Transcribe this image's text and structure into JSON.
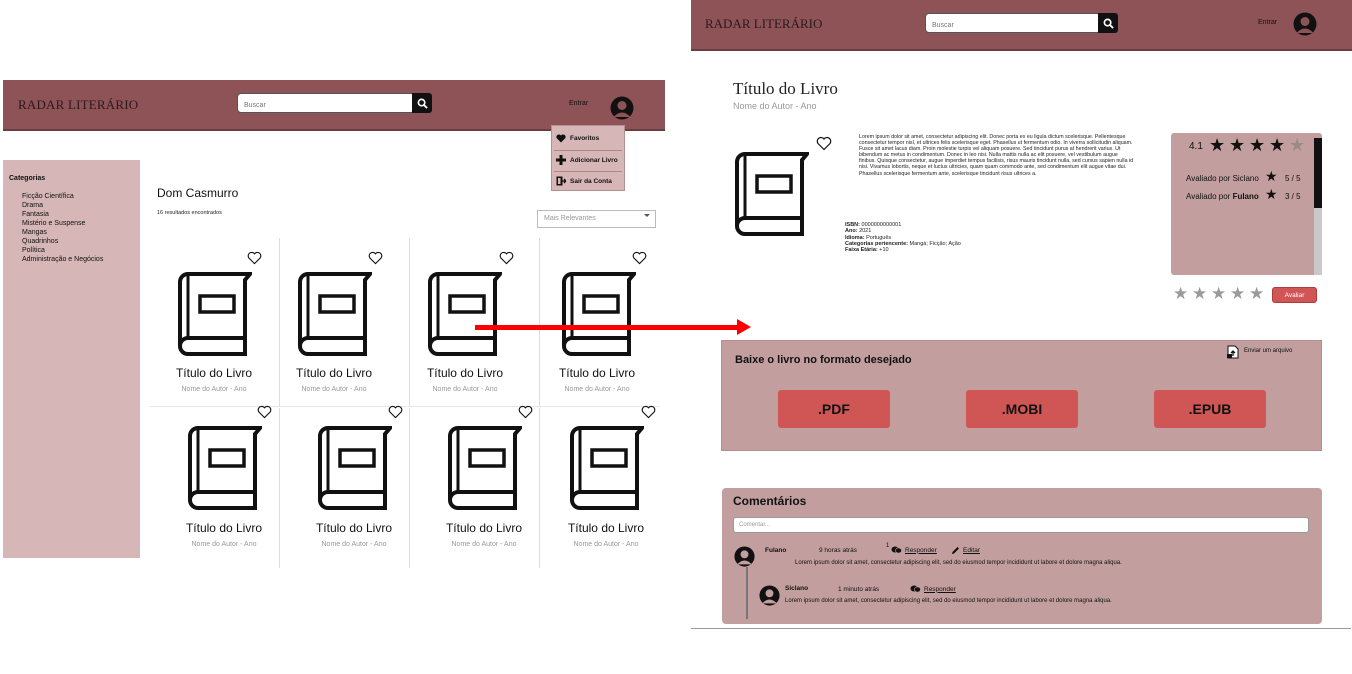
{
  "colors": {
    "header": "#8e5357",
    "panel": "#d6b6b6",
    "box": "#c29e9e",
    "accent_button": "#d05656",
    "arrow": "#ff0000"
  },
  "left_page": {
    "logo": "RADAR LITERÁRIO",
    "search_placeholder": "Buscar",
    "login_label": "Entrar",
    "user_menu": [
      {
        "label": "Favoritos",
        "icon": "heart-icon"
      },
      {
        "label": "Adicionar Livro",
        "icon": "plus-icon"
      },
      {
        "label": "Sair da Conta",
        "icon": "logout-icon"
      }
    ],
    "sidebar": {
      "title": "Categorias",
      "items": [
        "Ficção Científica",
        "Drama",
        "Fantasia",
        "Mistério e Suspense",
        "Mangas",
        "Quadrinhos",
        "Política",
        "Administração e Negócios"
      ]
    },
    "search_query": "Dom Casmurro",
    "results_count": "16 resultados encontrados",
    "sort_selected": "Mais Relevantes",
    "cards": [
      {
        "title": "Título do Livro",
        "author": "Nome do Autor - Ano"
      },
      {
        "title": "Título do Livro",
        "author": "Nome do Autor - Ano"
      },
      {
        "title": "Título do Livro",
        "author": "Nome do Autor - Ano"
      },
      {
        "title": "Título do Livro",
        "author": "Nome do Autor - Ano"
      },
      {
        "title": "Título do Livro",
        "author": "Nome do Autor - Ano"
      },
      {
        "title": "Título do Livro",
        "author": "Nome do Autor - Ano"
      },
      {
        "title": "Título do Livro",
        "author": "Nome do Autor - Ano"
      },
      {
        "title": "Título do Livro",
        "author": "Nome do Autor - Ano"
      }
    ]
  },
  "right_page": {
    "logo": "RADAR LITERÁRIO",
    "search_placeholder": "Buscar",
    "login_label": "Entrar",
    "book_title": "Título do Livro",
    "book_author": "Nome do Autor - Ano",
    "description": "Lorem ipsum dolor sit amet, consectetur adipiscing elit. Donec porta ex eu ligula dictum scelerisque. Pellentesque consectetur tempor nisl, et ultrices felis scelerisque eget. Phasellus ut fermentum odio. In viverra sollicitudin aliquam. Fusce sit amet lacus diam. Proin molestie turpis vel aliquam posuere. Sed tincidunt purus at hendrerit varius. Ut bibendum ac metus in condimentum. Donec in leo nisi. Nulla mattis nulla ac elit posuere, vel vestibulum augue finibus. Quisque consectetur, augue imperdiet tempus facilisis, risus mauris tincidunt nulla, sed cursus sapien nulla id nisi. Vivamus lobortis, neque et luctus ultricies, quam quam commodo ante, sed condimentum elit augue vitae dui. Phasellus scelerisque fermentum ante, scelerisque tincidunt risus ultrices a.",
    "meta": {
      "isbn_label": "ISBN:",
      "isbn": "0000000000001",
      "year_label": "Ano:",
      "year": "2021",
      "language_label": "Idioma:",
      "language": "Português",
      "categories_label": "Categorias pertencente:",
      "categories": "Mangá; Ficção; Ação",
      "age_label": "Faixa Etária:",
      "age": "+10"
    },
    "rating": {
      "average": "4.1",
      "average_stars": 4,
      "reviews": [
        {
          "prefix": "Avaliado por",
          "name": "Siclano",
          "score": "5 / 5"
        },
        {
          "prefix": "Avaliado por",
          "name": "Fulano",
          "score": "3 / 5"
        }
      ],
      "rate_button": "Avaliar"
    },
    "download": {
      "title": "Baixe o livro no formato desejado",
      "upload_label": "Enviar um arquivo",
      "formats": [
        ".PDF",
        ".MOBI",
        ".EPUB"
      ]
    },
    "comments": {
      "title": "Comentários",
      "placeholder": "Comentar...",
      "items": [
        {
          "name": "Fulano",
          "time": "9 horas atrás",
          "reply_count": "1",
          "reply_label": "Responder",
          "edit_label": "Editar",
          "text": "Lorem ipsum dolor sit amet, consectetur adipiscing elit, sed do eiusmod tempor incididunt ut labore et dolore magna aliqua."
        },
        {
          "name": "Siclano",
          "time": "1 minuto atrás",
          "reply_label": "Responder",
          "text": "Lorem ipsum dolor sit amet, consectetur adipiscing elit, sed do eiusmod tempor incididunt ut labore et dolore magna aliqua."
        }
      ]
    }
  }
}
